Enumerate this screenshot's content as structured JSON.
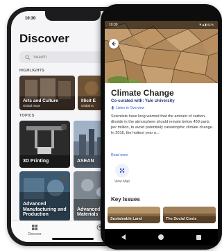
{
  "ios_app": {
    "time": "10:30",
    "heading": "Discover",
    "search_placeholder": "Search",
    "highlights_label": "HIGHLIGHTS",
    "highlights": [
      {
        "title": "Arts and Culture",
        "subtitle": "Global Issue"
      },
      {
        "title": "Illicit E",
        "subtitle": "Global Is"
      }
    ],
    "topics_label": "TOPICS",
    "topics": [
      {
        "title": "3D Printing"
      },
      {
        "title": "ASEAN"
      },
      {
        "title": "Advanced Manufacturing and Production"
      },
      {
        "title": "Advanced Materials"
      }
    ],
    "tabs": [
      {
        "label": "Discover",
        "icon": "discover-icon"
      },
      {
        "label": "",
        "icon": "profile-icon"
      }
    ]
  },
  "android_app": {
    "time": "10:30",
    "status_icons": "▼▲▮ 61%",
    "title": "Climate Change",
    "curated_by": "Co-curated with: Yale University",
    "listen_label": "Listen to Overview",
    "body": "Scientists have long warned that the amount of carbon-dioxide in the atmosphere should remain below 450 parts per million, to avoid potentially catastrophic climate change. In 2016, the hottest year o...",
    "read_more": "Read more",
    "view_map_label": "View Map",
    "key_issues_label": "Key Issues",
    "key_issues": [
      {
        "title": "Sustainable Land"
      },
      {
        "title": "The Social Costs"
      }
    ]
  },
  "colors": {
    "accent_blue": "#3760c4",
    "curator_navy": "#223a7a"
  }
}
